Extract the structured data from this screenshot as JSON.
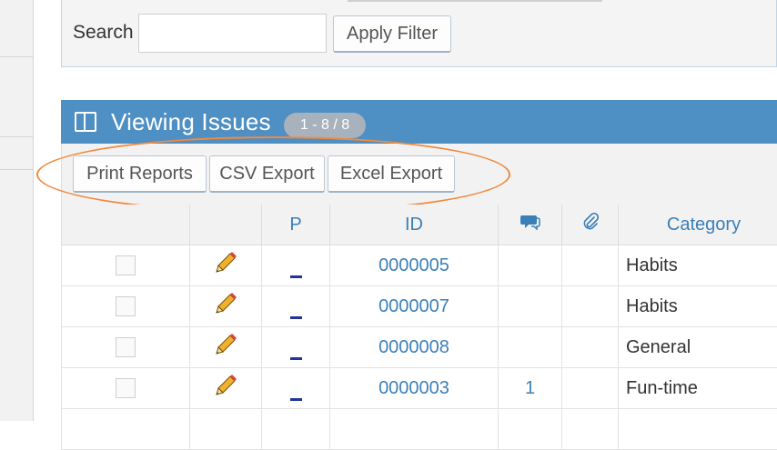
{
  "filter": {
    "search_label": "Search",
    "search_value": "",
    "apply_label": "Apply Filter"
  },
  "widget": {
    "title": "Viewing Issues",
    "badge": "1 - 8 / 8",
    "header_color": "#4e8fc4"
  },
  "toolbar": {
    "print_label": "Print Reports",
    "csv_label": "CSV Export",
    "excel_label": "Excel Export"
  },
  "annotation": {
    "shape": "oval",
    "color": "#f08a3e"
  },
  "table": {
    "columns": {
      "select": "",
      "edit": "",
      "priority": "P",
      "id": "ID",
      "notes_icon": "comments-icon",
      "attachments_icon": "paperclip-icon",
      "category": "Category"
    },
    "rows": [
      {
        "id": "0000005",
        "notes": "",
        "category": "Habits",
        "priority_icon": "normal-priority-icon"
      },
      {
        "id": "0000007",
        "notes": "",
        "category": "Habits",
        "priority_icon": "normal-priority-icon"
      },
      {
        "id": "0000008",
        "notes": "",
        "category": "General",
        "priority_icon": "normal-priority-icon"
      },
      {
        "id": "0000003",
        "notes": "1",
        "category": "Fun-time",
        "priority_icon": "normal-priority-icon"
      }
    ]
  }
}
